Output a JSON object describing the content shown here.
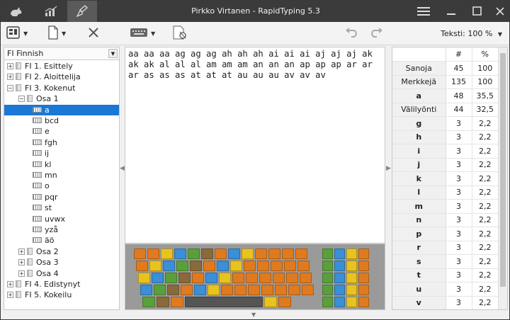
{
  "window": {
    "title": "Pirkko Virtanen - RapidTyping 5.3"
  },
  "toolbar": {
    "text_size": "Teksti: 100 %"
  },
  "left": {
    "language": "FI Finnish",
    "tree": [
      {
        "label": "FI 1. Esittely",
        "exp": "+",
        "kind": "book",
        "level": 0
      },
      {
        "label": "FI 2. Aloittelija",
        "exp": "+",
        "kind": "book",
        "level": 0
      },
      {
        "label": "FI 3. Kokenut",
        "exp": "−",
        "kind": "book",
        "level": 0
      },
      {
        "label": "Osa 1",
        "exp": "−",
        "kind": "book",
        "level": 1
      },
      {
        "label": "a",
        "exp": "",
        "kind": "lesson",
        "level": 2,
        "selected": true
      },
      {
        "label": "bcd",
        "exp": "",
        "kind": "lesson",
        "level": 2
      },
      {
        "label": "e",
        "exp": "",
        "kind": "lesson",
        "level": 2
      },
      {
        "label": "fgh",
        "exp": "",
        "kind": "lesson",
        "level": 2
      },
      {
        "label": "ij",
        "exp": "",
        "kind": "lesson",
        "level": 2
      },
      {
        "label": "kl",
        "exp": "",
        "kind": "lesson",
        "level": 2
      },
      {
        "label": "mn",
        "exp": "",
        "kind": "lesson",
        "level": 2
      },
      {
        "label": "o",
        "exp": "",
        "kind": "lesson",
        "level": 2
      },
      {
        "label": "pqr",
        "exp": "",
        "kind": "lesson",
        "level": 2
      },
      {
        "label": "st",
        "exp": "",
        "kind": "lesson",
        "level": 2
      },
      {
        "label": "uvwx",
        "exp": "",
        "kind": "lesson",
        "level": 2
      },
      {
        "label": "yzå",
        "exp": "",
        "kind": "lesson",
        "level": 2
      },
      {
        "label": "äö",
        "exp": "",
        "kind": "lesson",
        "level": 2
      },
      {
        "label": "Osa 2",
        "exp": "+",
        "kind": "book",
        "level": 1
      },
      {
        "label": "Osa 3",
        "exp": "+",
        "kind": "book",
        "level": 1
      },
      {
        "label": "Osa 4",
        "exp": "+",
        "kind": "book",
        "level": 1
      },
      {
        "label": "FI 4. Edistynyt",
        "exp": "+",
        "kind": "book",
        "level": 0
      },
      {
        "label": "FI 5. Kokeilu",
        "exp": "+",
        "kind": "book",
        "level": 0
      }
    ]
  },
  "lesson_text": [
    "aa aa aa ag ag ag ah ah ah ai ai ai aj aj aj ak",
    "ak ak al al al am am am an an an ap ap ap ar ar",
    "ar as as as at at at au au au av av av"
  ],
  "stats": {
    "col_count": "#",
    "col_pct": "%",
    "rows": [
      {
        "label": "Sanoja",
        "count": "45",
        "pct": "100",
        "bold": false
      },
      {
        "label": "Merkkejä",
        "count": "135",
        "pct": "100",
        "bold": false
      },
      {
        "label": "a",
        "count": "48",
        "pct": "35,5",
        "bold": true
      },
      {
        "label": "Välilyönti",
        "count": "44",
        "pct": "32,5",
        "bold": false
      },
      {
        "label": "g",
        "count": "3",
        "pct": "2,2",
        "bold": true
      },
      {
        "label": "h",
        "count": "3",
        "pct": "2,2",
        "bold": true
      },
      {
        "label": "i",
        "count": "3",
        "pct": "2,2",
        "bold": true
      },
      {
        "label": "j",
        "count": "3",
        "pct": "2,2",
        "bold": true
      },
      {
        "label": "k",
        "count": "3",
        "pct": "2,2",
        "bold": true
      },
      {
        "label": "l",
        "count": "3",
        "pct": "2,2",
        "bold": true
      },
      {
        "label": "m",
        "count": "3",
        "pct": "2,2",
        "bold": true
      },
      {
        "label": "n",
        "count": "3",
        "pct": "2,2",
        "bold": true
      },
      {
        "label": "p",
        "count": "3",
        "pct": "2,2",
        "bold": true
      },
      {
        "label": "r",
        "count": "3",
        "pct": "2,2",
        "bold": true
      },
      {
        "label": "s",
        "count": "3",
        "pct": "2,2",
        "bold": true
      },
      {
        "label": "t",
        "count": "3",
        "pct": "2,2",
        "bold": true
      },
      {
        "label": "u",
        "count": "3",
        "pct": "2,2",
        "bold": true
      },
      {
        "label": "v",
        "count": "3",
        "pct": "2,2",
        "bold": true
      }
    ]
  },
  "colors": {
    "titlebar": "#3b3b3b",
    "selection": "#1b78d6",
    "keyboard_bg": "#9a9a9a"
  },
  "icons": [
    "rabbit-icon",
    "chart-icon",
    "broom-icon",
    "menu-icon",
    "minimize-icon",
    "maximize-icon",
    "close-icon",
    "course-icon",
    "new-file-icon",
    "delete-icon",
    "keyboard-icon",
    "settings-icon",
    "undo-icon",
    "redo-icon"
  ]
}
